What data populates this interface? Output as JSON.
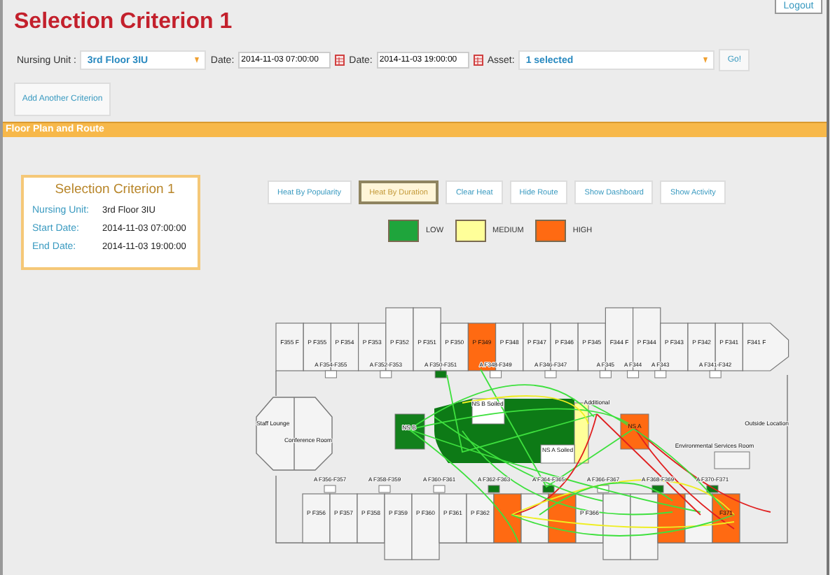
{
  "header": {
    "title": "Selection Criterion 1",
    "logout": "Logout"
  },
  "filters": [
    {
      "kind": "select",
      "label": "Nursing Unit :",
      "value": "3rd Floor 3IU"
    },
    {
      "kind": "date",
      "label": "Date:",
      "value": "2014-11-03 07:00:00"
    },
    {
      "kind": "date",
      "label": "Date:",
      "value": "2014-11-03 19:00:00"
    },
    {
      "kind": "select",
      "label": "Asset:",
      "value": "1 selected"
    }
  ],
  "go_button": "Go!",
  "add_criterion_button": "Add Another Criterion",
  "section_title": "Floor Plan and Route",
  "summary": {
    "title": "Selection Criterion 1",
    "rows": [
      {
        "label": "Nursing Unit:",
        "value": "3rd Floor 3IU"
      },
      {
        "label": "Start Date:",
        "value": "2014-11-03 07:00:00"
      },
      {
        "label": "End Date:",
        "value": "2014-11-03 19:00:00"
      }
    ]
  },
  "heat_buttons": [
    {
      "label": "Heat By Popularity",
      "selected": false
    },
    {
      "label": "Heat By Duration",
      "selected": true
    },
    {
      "label": "Clear Heat",
      "selected": false
    },
    {
      "label": "Hide Route",
      "selected": false
    },
    {
      "label": "Show Dashboard",
      "selected": false
    },
    {
      "label": "Show Activity",
      "selected": false
    }
  ],
  "legend": [
    {
      "label": "LOW",
      "color": "#1fa53c"
    },
    {
      "label": "MEDIUM",
      "color": "#ffff99"
    },
    {
      "label": "HIGH",
      "color": "#ff6a12"
    }
  ],
  "floor_plan": {
    "top_rooms": [
      {
        "label": "F355 F",
        "color": "#f4f4f4",
        "tall": false
      },
      {
        "label": "P F355",
        "color": "#f4f4f4",
        "tall": false
      },
      {
        "label": "P F354",
        "color": "#f4f4f4",
        "tall": false
      },
      {
        "label": "P F353",
        "color": "#f4f4f4",
        "tall": false
      },
      {
        "label": "P F352",
        "color": "#f4f4f4",
        "tall": true
      },
      {
        "label": "P F351",
        "color": "#f4f4f4",
        "tall": true
      },
      {
        "label": "P F350",
        "color": "#f4f4f4",
        "tall": false
      },
      {
        "label": "P F349",
        "color": "#ff6a12",
        "tall": false
      },
      {
        "label": "P F348",
        "color": "#f4f4f4",
        "tall": false
      },
      {
        "label": "P F347",
        "color": "#f4f4f4",
        "tall": false
      },
      {
        "label": "P F346",
        "color": "#f4f4f4",
        "tall": false
      },
      {
        "label": "P F345",
        "color": "#f4f4f4",
        "tall": false
      },
      {
        "label": "F344 F",
        "color": "#f4f4f4",
        "tall": true
      },
      {
        "label": "P F344",
        "color": "#f4f4f4",
        "tall": true
      },
      {
        "label": "P F343",
        "color": "#f4f4f4",
        "tall": false
      },
      {
        "label": "P F342",
        "color": "#f4f4f4",
        "tall": false
      },
      {
        "label": "P F341",
        "color": "#f4f4f4",
        "tall": false
      },
      {
        "label": "F341 F",
        "color": "#f4f4f4",
        "tall": false
      }
    ],
    "top_alcoves": [
      {
        "label": "A F354-F355",
        "color": "#ffffff"
      },
      {
        "label": "A F352-F353",
        "color": "#ffffff"
      },
      {
        "label": "A F350-F351",
        "color": "#0d7a16"
      },
      {
        "label": "A F348-F349",
        "color": "#ffffff"
      },
      {
        "label": "A F346-F347",
        "color": "#ffffff"
      },
      {
        "label": "A F345",
        "color": "#ffffff"
      },
      {
        "label": "A F344",
        "color": "#ffffff"
      },
      {
        "label": "A F343",
        "color": "#ffffff"
      },
      {
        "label": "A F341-F342",
        "color": "#ffffff"
      }
    ],
    "areas": [
      {
        "label": "Staff Lounge"
      },
      {
        "label": "Conference Room"
      },
      {
        "label": "NS B",
        "color": "#13801c"
      },
      {
        "label": "NS B Soiled",
        "color": "#ffffff"
      },
      {
        "label": "Additional",
        "color": "#ffff99"
      },
      {
        "label": "NS A",
        "color": "#ff6a12"
      },
      {
        "label": "NS A Soiled",
        "color": "#ffffff"
      },
      {
        "label": "Outside Location"
      },
      {
        "label": "Environmental Services Room",
        "color": "#f4f4f4"
      }
    ],
    "bottom_alcoves": [
      {
        "label": "A F356-F357",
        "color": "#ffffff"
      },
      {
        "label": "A F358-F359",
        "color": "#ffffff"
      },
      {
        "label": "A F360-F361",
        "color": "#ffffff"
      },
      {
        "label": "A F362-F363",
        "color": "#0d7a16"
      },
      {
        "label": "A F364-F365",
        "color": "#0d7a16"
      },
      {
        "label": "A F366-F367",
        "color": "#ffffff"
      },
      {
        "label": "A F368-F369",
        "color": "#0d7a16"
      },
      {
        "label": "A F370-F371",
        "color": "#0d7a16"
      }
    ],
    "bottom_rooms": [
      {
        "label": "P F356",
        "color": "#f4f4f4",
        "tall": false
      },
      {
        "label": "P F357",
        "color": "#f4f4f4",
        "tall": false
      },
      {
        "label": "P F358",
        "color": "#f4f4f4",
        "tall": false
      },
      {
        "label": "P F359",
        "color": "#f4f4f4",
        "tall": true
      },
      {
        "label": "P F360",
        "color": "#f4f4f4",
        "tall": true
      },
      {
        "label": "P F361",
        "color": "#f4f4f4",
        "tall": false
      },
      {
        "label": "P F362",
        "color": "#f4f4f4",
        "tall": false
      },
      {
        "color": "#ff6a12",
        "tall": false
      },
      {
        "color": "#f4f4f4",
        "tall": false
      },
      {
        "color": "#ff6a12",
        "tall": false
      },
      {
        "label": "P F366",
        "color": "#f4f4f4",
        "tall": false
      },
      {
        "color": "#f4f4f4",
        "tall": true
      },
      {
        "color": "#f4f4f4",
        "tall": true
      },
      {
        "color": "#ff6a12",
        "tall": false
      },
      {
        "color": "#f4f4f4",
        "tall": false
      },
      {
        "label": "F371",
        "color": "#ff6a12",
        "tall": false
      }
    ]
  }
}
